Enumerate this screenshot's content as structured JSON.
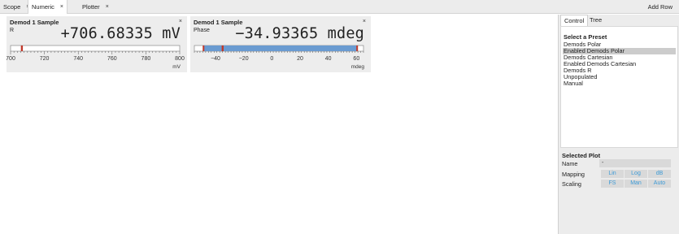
{
  "tabs": [
    {
      "label": "Scope",
      "close": "×"
    },
    {
      "label": "Numeric",
      "close": "×"
    },
    {
      "label": "Plotter",
      "close": "×"
    }
  ],
  "toolbar": {
    "add_row": "Add Row"
  },
  "widgets": [
    {
      "title": "Demod 1 Sample",
      "close": "×",
      "signal": "R",
      "value": "+706.68335 mV",
      "unit": "mV",
      "scale": {
        "min": 700,
        "max": 800,
        "ticks": [
          "700",
          "720",
          "740",
          "760",
          "780",
          "800"
        ]
      },
      "marker_value": 706.68,
      "fill_color": "#ffffff",
      "marker_color": "#c0392b"
    },
    {
      "title": "Demod 1 Sample",
      "close": "×",
      "signal": "Phase",
      "value": "−34.93365 mdeg",
      "unit": "mdeg",
      "scale": {
        "min": -55,
        "max": 65,
        "ticks": [
          "−40",
          "−20",
          "0",
          "20",
          "40",
          "60"
        ],
        "tick_values": [
          -40,
          -20,
          0,
          20,
          40,
          60
        ]
      },
      "marker_value": -34.93,
      "marker2_value": -48.5,
      "range_max_value": 60.5,
      "fill_color": "#6a9bd1",
      "marker_color": "#c0392b"
    }
  ],
  "panel": {
    "tabs": [
      "Control",
      "Tree"
    ],
    "preset_title": "Select a Preset",
    "presets": [
      "Demods Polar",
      "Enabled Demods Polar",
      "Demods Cartesian",
      "Enabled Demods Cartesian",
      "Demods R",
      "Unpopulated",
      "Manual"
    ],
    "selected_preset_index": 1,
    "selected_plot_title": "Selected Plot",
    "name_label": "Name",
    "name_value": "-",
    "mapping_label": "Mapping",
    "mapping_options": [
      "Lin",
      "Log",
      "dB"
    ],
    "scaling_label": "Scaling",
    "scaling_options": [
      "FS",
      "Man",
      "Auto"
    ],
    "accent_color": "#3d9ad6"
  }
}
